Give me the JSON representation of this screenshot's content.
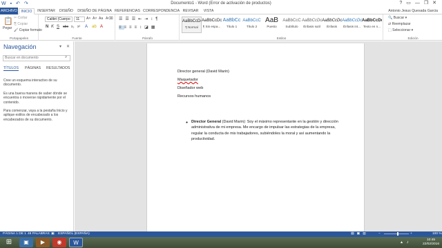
{
  "window": {
    "title": "Documento1 - Word (Error de activación de productos)",
    "qat_icons": [
      "word-icon",
      "save-icon",
      "undo-icon",
      "redo-icon"
    ],
    "controls": [
      "?",
      "▭",
      "—",
      "❐",
      "✕"
    ]
  },
  "tabs": {
    "file": "ARCHIVO",
    "items": [
      "INICIO",
      "INSERTAR",
      "DISEÑO",
      "DISEÑO DE PÁGINA",
      "REFERENCIAS",
      "CORRESPONDENCIA",
      "REVISAR",
      "VISTA"
    ],
    "active": "INICIO",
    "user": "Antonio Jesus Quesada Garcia"
  },
  "ribbon": {
    "clipboard": {
      "paste": "Pegar",
      "cut": "Cortar",
      "copy": "Copiar",
      "format_painter": "Copiar formato",
      "label": "Portapapeles"
    },
    "font": {
      "name": "Calibri (Cuerpo",
      "size": "11",
      "label": "Fuente",
      "buttons": [
        "N",
        "K",
        "S",
        "abc",
        "x₂",
        "x²"
      ]
    },
    "paragraph": {
      "label": "Párrafo"
    },
    "styles": {
      "label": "Estilos",
      "items": [
        {
          "preview": "AaBbCcDc",
          "name": "¶ Normal",
          "selected": true
        },
        {
          "preview": "AaBbCcDc",
          "name": "¶ Sin espa..."
        },
        {
          "preview": "AaBbCc",
          "name": "Título 1"
        },
        {
          "preview": "AaBbCcC",
          "name": "Título 2"
        },
        {
          "preview": "AaB",
          "name": "Puesto"
        },
        {
          "preview": "AaBbCcC",
          "name": "Subtítulo"
        },
        {
          "preview": "AaBbCcDc",
          "name": "Énfasis sutil"
        },
        {
          "preview": "AaBbCcDc",
          "name": "Énfasis"
        },
        {
          "preview": "AaBbCcDc",
          "name": "Énfasis int..."
        },
        {
          "preview": "AaBbCcDc",
          "name": "Texto en n..."
        }
      ]
    },
    "editing": {
      "label": "Edición",
      "find": "Buscar",
      "replace": "Reemplazar",
      "select": "Seleccionar"
    }
  },
  "nav": {
    "title": "Navegación",
    "search_placeholder": "Buscar en documento",
    "tabs": [
      "TÍTULOS",
      "PÁGINAS",
      "RESULTADOS"
    ],
    "paragraphs": [
      "Cree un esquema interactivo de su documento.",
      "Es una buena manera de saber dónde se encuentra o moverse rápidamente por el contenido.",
      "Para comenzar, vaya a la pestaña Inicio y aplique estilos de encabezado a los encabezados de su documento."
    ]
  },
  "document": {
    "lines": [
      "Director general (David Marin)",
      "Maquetador",
      "Diseñador web",
      "Recursos humanos"
    ],
    "bullet": {
      "bold": "Director General",
      "rest": " (David Marin): Soy el máximo representante en la gestión y dirección administrativa de mi empresa. Me encargo de impulsar las estrategias de la empresa, regular la conducta de mis trabajadores, subiéndoles la moral y así aumentando la productividad."
    }
  },
  "status": {
    "page": "PÁGINA 1 DE 1",
    "words": "48 PALABRAS",
    "lang": "ESPAÑOL (ESPAÑA)",
    "zoom": "100 %"
  },
  "taskbar": {
    "time": "10:45",
    "date": "22/02/2016"
  },
  "colors": {
    "accent": "#2b579a",
    "taskbar": "#4a5a42"
  }
}
